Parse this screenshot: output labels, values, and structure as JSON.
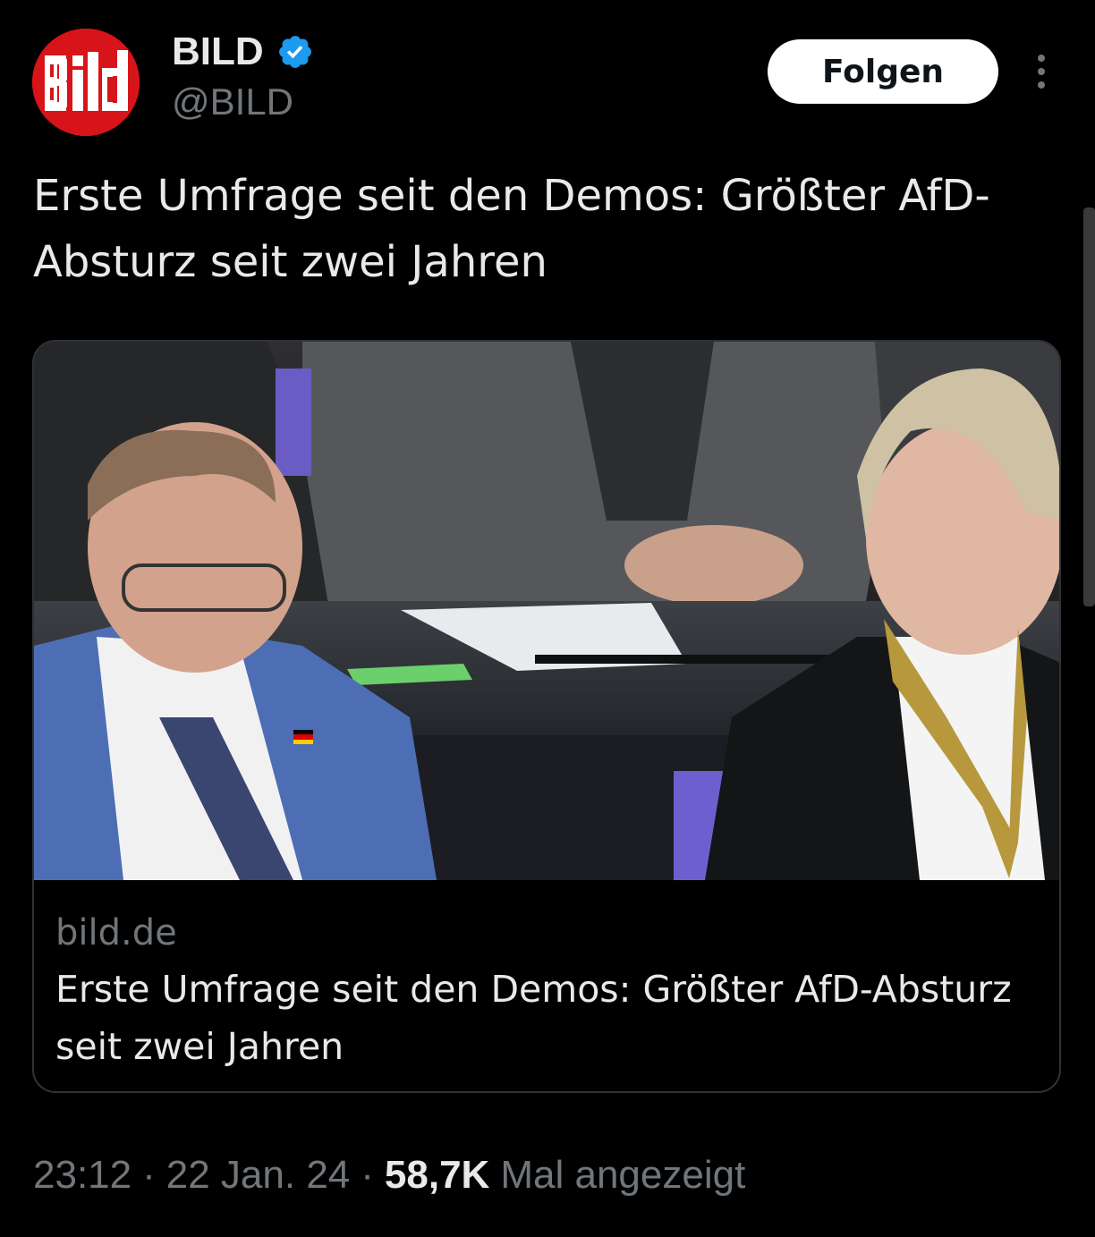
{
  "account": {
    "display_name": "BILD",
    "handle": "@BILD",
    "verified": true,
    "avatar_logo": "Bild",
    "brand_color": "#d7141a",
    "verified_color": "#1d9bf0"
  },
  "actions": {
    "follow_label": "Folgen",
    "more_icon": "more-vertical-icon"
  },
  "tweet": {
    "text": "Erste Umfrage seit den Demos: Größter AfD-Absturz seit zwei Jahren"
  },
  "link_card": {
    "domain": "bild.de",
    "title": "Erste Umfrage seit den Demos: Größter AfD-Absturz seit zwei Jahren"
  },
  "meta": {
    "time": "23:12",
    "separator": "·",
    "date": "22 Jan. 24",
    "views_count": "58,7K",
    "views_label": "Mal angezeigt"
  }
}
